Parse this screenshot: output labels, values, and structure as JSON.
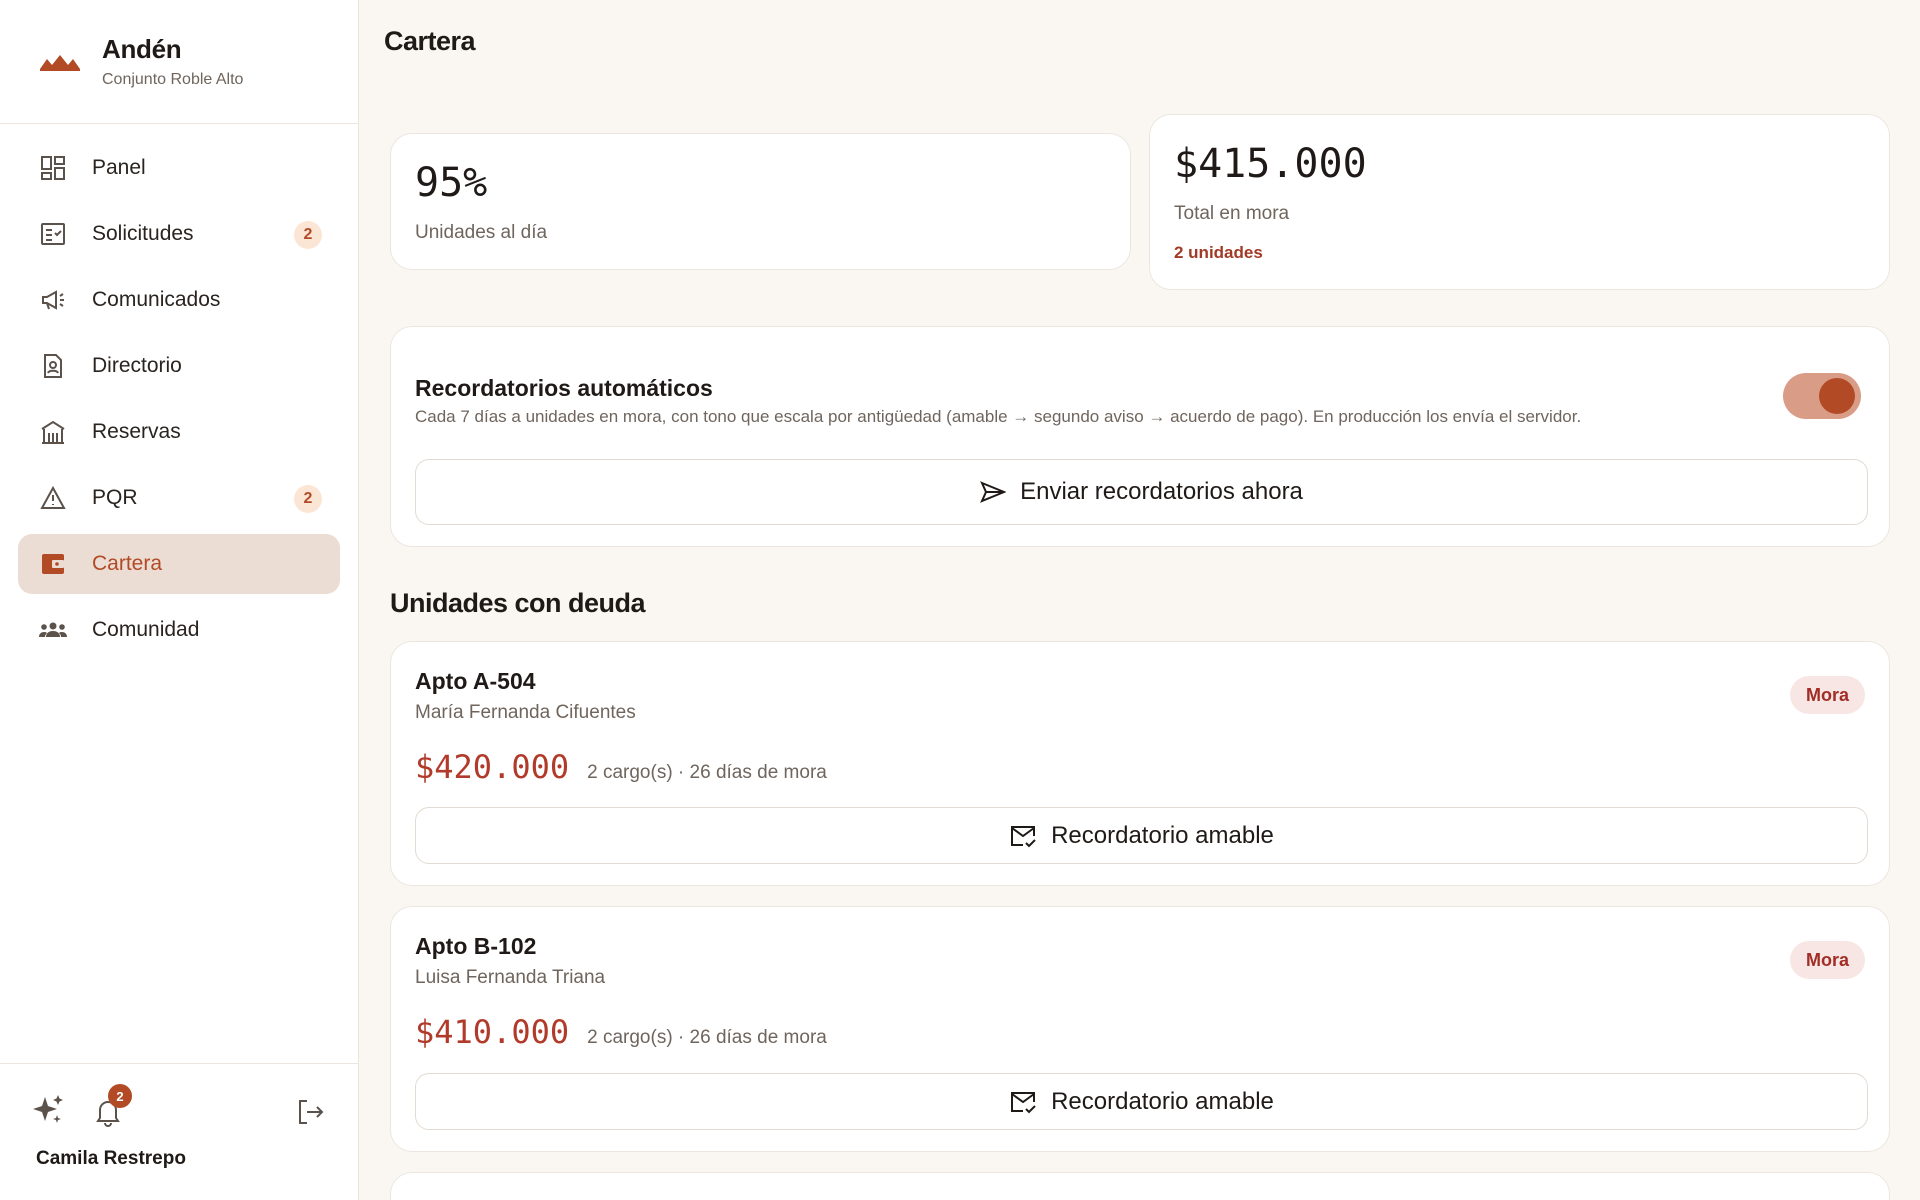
{
  "brand": {
    "name": "Andén",
    "subtitle": "Conjunto Roble Alto"
  },
  "sidebar": {
    "items": [
      {
        "label": "Panel",
        "icon": "dashboard-icon",
        "badge": null
      },
      {
        "label": "Solicitudes",
        "icon": "checklist-icon",
        "badge": "2"
      },
      {
        "label": "Comunicados",
        "icon": "megaphone-icon",
        "badge": null
      },
      {
        "label": "Directorio",
        "icon": "contact-card-icon",
        "badge": null
      },
      {
        "label": "Reservas",
        "icon": "building-icon",
        "badge": null
      },
      {
        "label": "PQR",
        "icon": "warning-icon",
        "badge": "2"
      },
      {
        "label": "Cartera",
        "icon": "wallet-icon",
        "badge": null,
        "active": true
      },
      {
        "label": "Comunidad",
        "icon": "people-icon",
        "badge": null
      }
    ],
    "footer": {
      "notifications": "2",
      "user_name": "Camila Restrepo"
    }
  },
  "main": {
    "title": "Cartera",
    "stats": {
      "ontime": {
        "value": "95%",
        "label": "Unidades al día"
      },
      "overdue": {
        "value": "$415.000",
        "label": "Total en mora",
        "note": "2 unidades"
      }
    },
    "reminders": {
      "title": "Recordatorios automáticos",
      "description": "Cada 7 días a unidades en mora, con tono que escala por antigüedad (amable → segundo aviso → acuerdo de pago). En producción los envía el servidor.",
      "enabled": true,
      "button": "Enviar recordatorios ahora"
    },
    "debts_title": "Unidades con deuda",
    "units": [
      {
        "name": "Apto A-504",
        "owner": "María Fernanda Cifuentes",
        "amount": "$420.000",
        "meta": "2 cargo(s) · 26 días de mora",
        "tag": "Mora",
        "button": "Recordatorio amable"
      },
      {
        "name": "Apto B-102",
        "owner": "Luisa Fernanda Triana",
        "amount": "$410.000",
        "meta": "2 cargo(s) · 26 días de mora",
        "tag": "Mora",
        "button": "Recordatorio amable"
      }
    ]
  },
  "colors": {
    "accent": "#b24a26",
    "danger": "#b23a2a",
    "background": "#faf7f2"
  }
}
